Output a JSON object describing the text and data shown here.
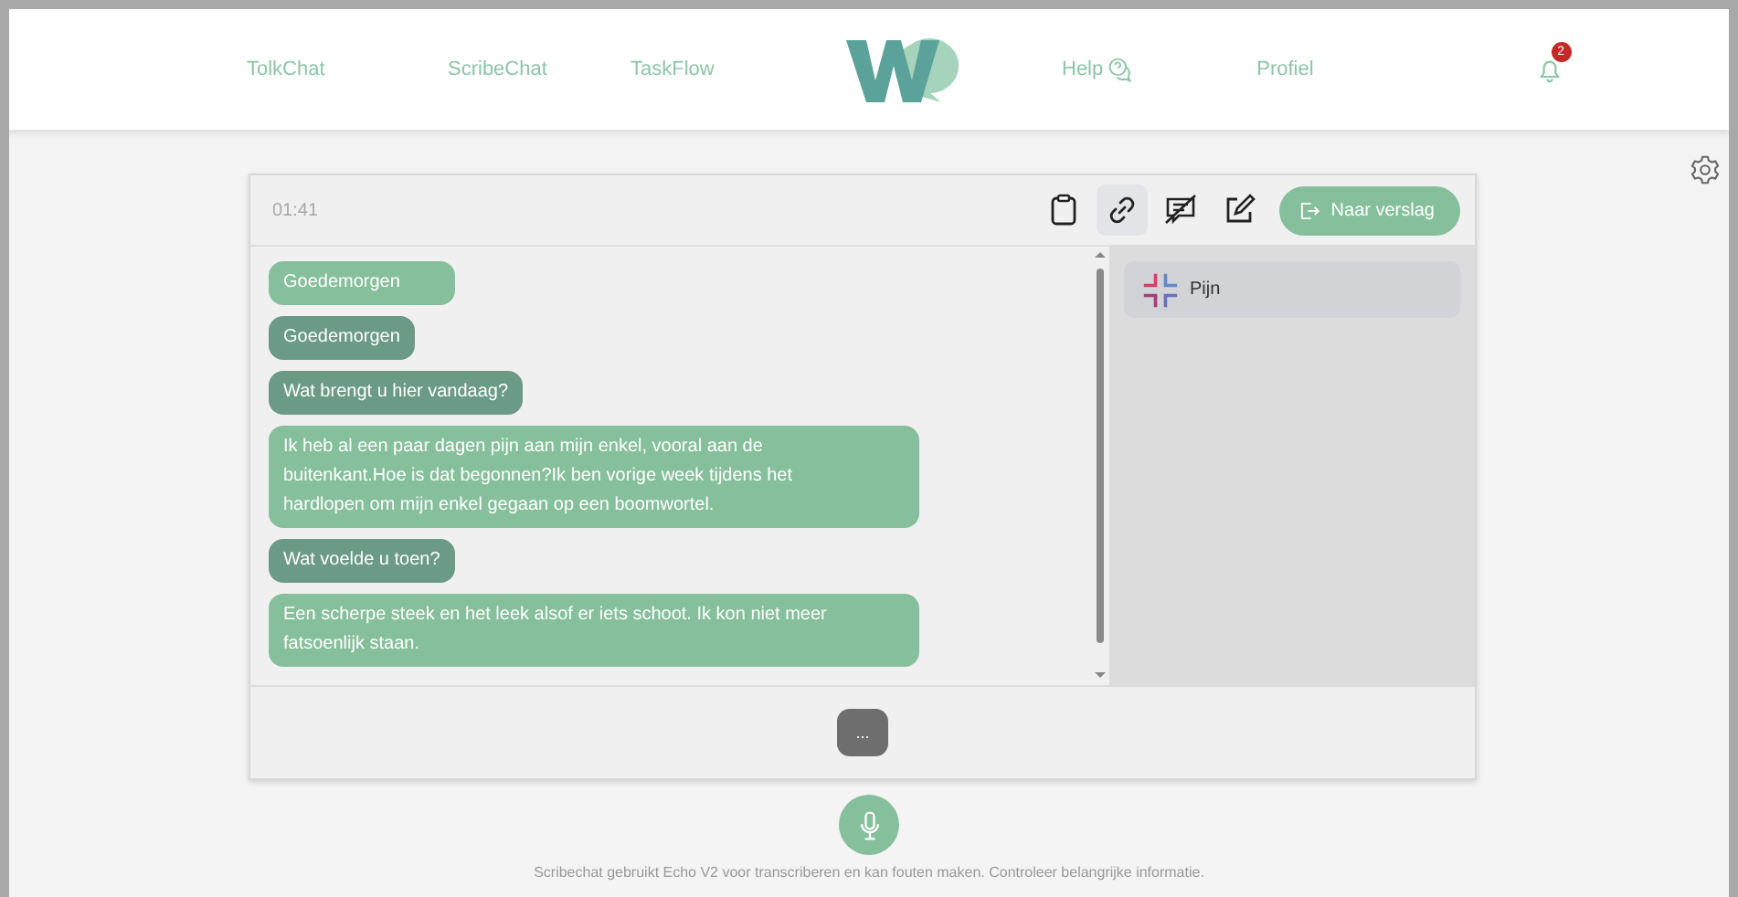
{
  "nav": {
    "left": [
      {
        "label": "TolkChat"
      },
      {
        "label": "ScribeChat"
      },
      {
        "label": "TaskFlow"
      }
    ],
    "right": [
      {
        "label": "Help",
        "kind": "help"
      },
      {
        "label": "Profiel",
        "kind": "plain"
      }
    ],
    "notifications": {
      "count": "2"
    }
  },
  "session": {
    "timer": "01:41",
    "tools": [
      {
        "kind": "clipboard",
        "selected": false
      },
      {
        "kind": "link",
        "selected": true
      },
      {
        "kind": "mute-chat",
        "selected": false
      },
      {
        "kind": "edit",
        "selected": false
      }
    ],
    "report_button": "Naar verslag",
    "messages": [
      {
        "kind": "patient",
        "text": "Goedemorgen"
      },
      {
        "kind": "doctor",
        "text": "Goedemorgen"
      },
      {
        "kind": "doctor",
        "text": "Wat brengt u hier vandaag?"
      },
      {
        "kind": "patient",
        "text": "Ik heb al een paar dagen pijn aan mijn enkel, vooral aan de buitenkant.Hoe is dat begonnen?Ik ben vorige week tijdens het hardlopen om mijn enkel gegaan op een boomwortel."
      },
      {
        "kind": "doctor",
        "text": "Wat voelde u toen?"
      },
      {
        "kind": "patient",
        "text": "Een scherpe steek en het leek alsof er iets schoot. Ik kon niet meer fatsoenlijk staan."
      }
    ],
    "findings": [
      {
        "label": "Pijn"
      }
    ],
    "more_button": "..."
  },
  "footer": "Scribechat gebruikt Echo V2 voor transcriberen en kan fouten maken. Controleer belangrijke informatie."
}
